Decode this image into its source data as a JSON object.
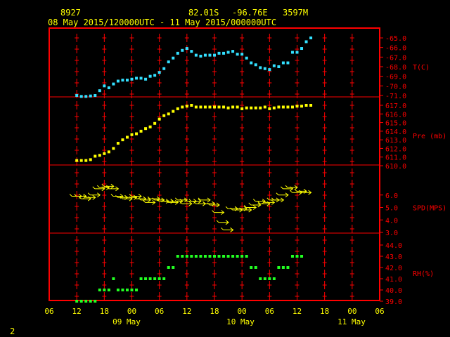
{
  "header": {
    "station_id": "8927",
    "lat": "82.01S",
    "lon": "-96.76E",
    "elevation": "3597M",
    "time_range": "08 May 2015/120000UTC - 11 May 2015/000000UTC"
  },
  "page_number": "2",
  "colors": {
    "frame": "#ff0000",
    "text": "#ffff00",
    "temperature": "#33e0ff",
    "pressure": "#ffff00",
    "wind": "#ffff00",
    "humidity": "#22ff22",
    "background": "#000000"
  },
  "chart_data": {
    "type": "scatter",
    "x_hours_range": [
      -6,
      66
    ],
    "x_tick_labels": [
      "06",
      "12",
      "18",
      "00",
      "06",
      "12",
      "18",
      "00",
      "06",
      "12",
      "18",
      "00",
      "06"
    ],
    "date_labels": [
      "09 May",
      "10 May",
      "11 May"
    ],
    "panels": [
      {
        "key": "temperature",
        "label": "T(C)",
        "ylim": [
          -71.0,
          -65.0
        ],
        "y_ticks": [
          "-65.0",
          "-66.0",
          "-67.0",
          "-68.0",
          "-69.0",
          "-70.0",
          "-71.0"
        ],
        "x": [
          0,
          1,
          2,
          3,
          4,
          5,
          6,
          7,
          8,
          9,
          10,
          11,
          12,
          13,
          14,
          15,
          16,
          17,
          18,
          19,
          20,
          21,
          22,
          23,
          24,
          25,
          26,
          27,
          28,
          29,
          30,
          31,
          32,
          33,
          34,
          35,
          36,
          37,
          38,
          39,
          40,
          41,
          42,
          43,
          44,
          45,
          46,
          47,
          48,
          49,
          50,
          51
        ],
        "y": [
          -71.0,
          -71.1,
          -71.1,
          -71.05,
          -71.0,
          -70.5,
          -70.0,
          -70.2,
          -69.8,
          -69.5,
          -69.4,
          -69.4,
          -69.3,
          -69.2,
          -69.2,
          -69.3,
          -69.0,
          -68.9,
          -68.6,
          -68.2,
          -67.5,
          -67.1,
          -66.6,
          -66.3,
          -66.1,
          -66.4,
          -66.8,
          -66.9,
          -66.8,
          -66.8,
          -66.8,
          -66.6,
          -66.6,
          -66.5,
          -66.4,
          -66.7,
          -66.7,
          -67.1,
          -67.6,
          -67.8,
          -68.1,
          -68.2,
          -68.3,
          -67.9,
          -68.0,
          -67.6,
          -67.6,
          -66.5,
          -66.5,
          -66.1,
          -65.4,
          -65.0
        ]
      },
      {
        "key": "pressure",
        "label": "Pre (mb)",
        "ylim": [
          610.0,
          617.0
        ],
        "y_ticks": [
          "617.0",
          "616.0",
          "615.0",
          "614.0",
          "613.0",
          "612.0",
          "611.0",
          "610.0"
        ],
        "x": [
          0,
          1,
          2,
          3,
          4,
          5,
          6,
          7,
          8,
          9,
          10,
          11,
          12,
          13,
          14,
          15,
          16,
          17,
          18,
          19,
          20,
          21,
          22,
          23,
          24,
          25,
          26,
          27,
          28,
          29,
          30,
          31,
          32,
          33,
          34,
          35,
          36,
          37,
          38,
          39,
          40,
          41,
          42,
          43,
          44,
          45,
          46,
          47,
          48,
          49,
          50,
          51
        ],
        "y": [
          610.6,
          610.6,
          610.6,
          610.7,
          611.1,
          611.2,
          611.4,
          611.6,
          612.0,
          612.6,
          613.0,
          613.3,
          613.6,
          613.7,
          614.0,
          614.3,
          614.5,
          614.9,
          615.4,
          615.8,
          616.0,
          616.3,
          616.6,
          616.8,
          616.9,
          617.0,
          616.8,
          616.8,
          616.8,
          616.8,
          616.8,
          616.8,
          616.8,
          616.7,
          616.8,
          616.8,
          616.6,
          616.7,
          616.7,
          616.7,
          616.7,
          616.8,
          616.6,
          616.7,
          616.8,
          616.8,
          616.8,
          616.8,
          616.9,
          616.9,
          617.0,
          617.0
        ]
      },
      {
        "key": "wind_speed",
        "label": "SPD(MPS)",
        "ylim": [
          3.0,
          7.0
        ],
        "y_ticks": [
          "6.0",
          "5.0",
          "4.0",
          "3.0"
        ],
        "x": [
          0,
          1,
          2,
          3,
          4,
          5,
          6,
          7,
          8,
          9,
          10,
          11,
          12,
          13,
          14,
          15,
          16,
          17,
          18,
          19,
          20,
          21,
          22,
          23,
          24,
          25,
          26,
          27,
          28,
          29,
          30,
          31,
          32,
          33,
          34,
          35,
          36,
          37,
          38,
          39,
          40,
          41,
          42,
          43,
          44,
          45,
          46,
          47,
          48,
          49,
          50
        ],
        "y": [
          5.9,
          5.9,
          5.7,
          5.8,
          6.0,
          6.5,
          6.6,
          6.7,
          6.5,
          5.9,
          5.8,
          5.7,
          5.8,
          5.9,
          5.7,
          5.6,
          5.4,
          5.7,
          5.6,
          5.5,
          5.5,
          5.4,
          5.5,
          5.6,
          5.3,
          5.5,
          5.5,
          5.3,
          5.6,
          5.3,
          5.2,
          4.6,
          3.8,
          3.2,
          4.9,
          4.8,
          4.9,
          4.8,
          5.0,
          5.2,
          5.5,
          5.3,
          5.4,
          5.6,
          5.6,
          6.0,
          6.5,
          6.6,
          6.2,
          6.3,
          6.2
        ]
      },
      {
        "key": "humidity",
        "label": "RH(%)",
        "ylim": [
          39.0,
          44.0
        ],
        "y_ticks": [
          "44.0",
          "43.0",
          "42.0",
          "41.0",
          "40.0",
          "39.0"
        ],
        "x": [
          0,
          1,
          2,
          3,
          4,
          5,
          6,
          7,
          8,
          9,
          10,
          11,
          12,
          13,
          14,
          15,
          16,
          17,
          18,
          19,
          20,
          21,
          22,
          23,
          24,
          25,
          26,
          27,
          28,
          29,
          30,
          31,
          32,
          33,
          34,
          35,
          36,
          37,
          38,
          39,
          40,
          41,
          42,
          43,
          44,
          45,
          46,
          47,
          48,
          49
        ],
        "y": [
          39,
          39,
          39,
          39,
          39,
          40,
          40,
          40,
          41,
          40,
          40,
          40,
          40,
          40,
          41,
          41,
          41,
          41,
          41,
          41,
          42,
          42,
          43,
          43,
          43,
          43,
          43,
          43,
          43,
          43,
          43,
          43,
          43,
          43,
          43,
          43,
          43,
          43,
          42,
          42,
          41,
          41,
          41,
          41,
          42,
          42,
          42,
          43,
          43,
          43
        ]
      }
    ]
  }
}
